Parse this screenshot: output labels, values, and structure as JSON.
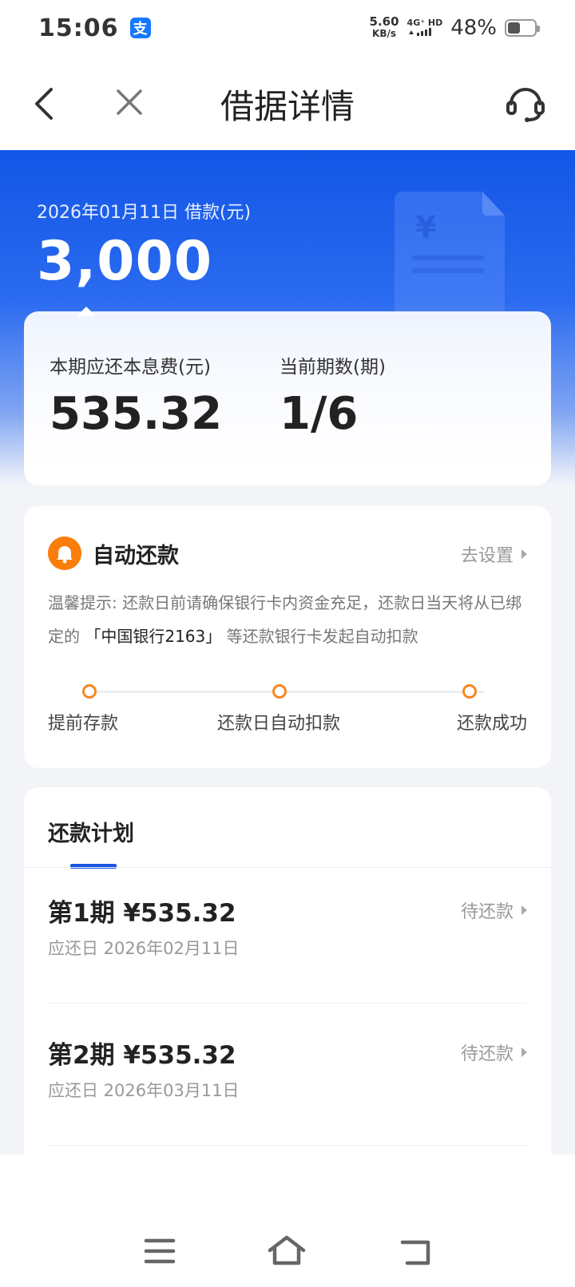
{
  "status_bar": {
    "time": "15:06",
    "app_badge": "支",
    "net_speed_value": "5.60",
    "net_speed_unit": "KB/s",
    "signal_label": "4G⁺ HD",
    "battery_percent": "48%",
    "battery_level": 0.48
  },
  "nav": {
    "title": "借据详情",
    "back_icon": "chevron-left-icon",
    "close_icon": "close-icon",
    "service_icon": "headset-icon"
  },
  "hero": {
    "date_label": "2026年01月11日 借款(元)",
    "amount": "3,000",
    "decor_icon": "yuan-document-icon"
  },
  "summary": {
    "due_label": "本期应还本息费(元)",
    "due_value": "535.32",
    "period_label": "当前期数(期)",
    "period_value": "1/6"
  },
  "auto_repay": {
    "title": "自动还款",
    "setting_link": "去设置",
    "tip_prefix": "温馨提示: 还款日前请确保银行卡内资金充足，还款日当天将从已绑定的",
    "bank": "「中国银行2163」",
    "tip_suffix": "等还款银行卡发起自动扣款",
    "steps": [
      "提前存款",
      "还款日自动扣款",
      "还款成功"
    ],
    "accent_color": "#f5881f"
  },
  "plan": {
    "title": "还款计划",
    "accent_color": "#1a55e3",
    "periods": [
      {
        "name": "第1期 ¥535.32",
        "date": "应还日 2026年02月11日",
        "status": "待还款"
      },
      {
        "name": "第2期 ¥535.32",
        "date": "应还日 2026年03月11日",
        "status": "待还款"
      }
    ]
  },
  "bottom_nav": {
    "menu_icon": "menu-icon",
    "home_icon": "home-icon",
    "back_icon": "back-icon"
  }
}
